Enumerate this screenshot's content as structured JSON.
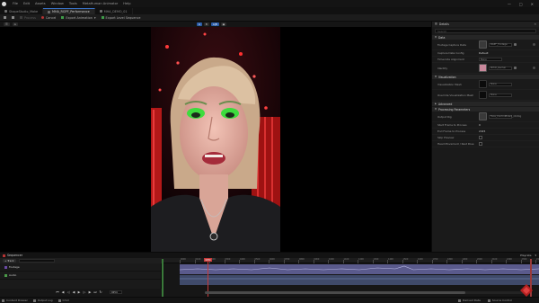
{
  "menubar": {
    "items": [
      "File",
      "Edit",
      "Assets",
      "Window",
      "Tools",
      "MetaHuman Animator",
      "Help"
    ]
  },
  "tabs": [
    {
      "label": "ShapeStudio_Make",
      "active": false
    },
    {
      "label": "MHA_RGPF_Performance",
      "active": true
    },
    {
      "label": "MHA_DEMO_01",
      "active": false
    }
  ],
  "toolbar": {
    "process": "Process",
    "cancel": "Cancel",
    "export_animation": "Export Animation",
    "export_level_sequence": "Export Level Sequence"
  },
  "viewport_strip": {
    "left_chips": [
      "☰",
      "A"
    ],
    "center_chips": [
      "A",
      "B",
      "A|B",
      "▣"
    ]
  },
  "details": {
    "title": "Details",
    "search_placeholder": "Search",
    "sections": {
      "data": "Data",
      "visualization": "Visualization",
      "advanced": "Advanced",
      "processing": "Processing Parameters"
    },
    "props": {
      "footage_capture_data": {
        "label": "Footage Capture Data",
        "value": "RGPF_Footage"
      },
      "capture_data_config": {
        "label": "Capture Data Config",
        "value": "Default"
      },
      "timecode_alignment": {
        "label": "Timecode Alignment",
        "value": "None"
      },
      "identity": {
        "label": "Identity",
        "value": "MHID_Rachel"
      },
      "visualization_mesh": {
        "label": "Visualization Mesh",
        "value": "None"
      },
      "control_rig": {
        "label": "Override Visualization Mesh",
        "value": "None"
      },
      "output_rig": {
        "label": "Output Rig",
        "value": "Face_ControlBoard_CtrlRig"
      },
      "start_frame": {
        "label": "Start Frame to Process",
        "value": "0"
      },
      "end_frame": {
        "label": "End Frame to Process",
        "value": "2415"
      },
      "skip_preview": {
        "label": "Skip Preview"
      },
      "neutral_pose": {
        "label": "Head Movement / Rest Pose"
      }
    }
  },
  "sequencer": {
    "tab_label": "Sequencer",
    "track_button": "+ Track",
    "right_label": "Playrate",
    "tracks": [
      "Footage",
      "Audio"
    ],
    "ruler_labels": [
      "0000",
      "0100",
      "0200",
      "0300",
      "0400",
      "0500",
      "0600",
      "0700",
      "0800",
      "0900",
      "1000",
      "1100",
      "1200",
      "1300",
      "1400",
      "1500",
      "1600",
      "1700",
      "1800",
      "1900",
      "2000",
      "2100",
      "2200",
      "2300",
      "2400"
    ],
    "playhead_frame": "0254",
    "current_frame": "0254"
  },
  "statusbar": {
    "content_drawer": "Content Drawer",
    "output_log": "Output Log",
    "cmd": "Cmd",
    "source_control": "Source Control",
    "derived_data": "Derived Data"
  },
  "colors": {
    "accent": "#3a74c9",
    "record": "#b43333",
    "playhead": "#c53a3a"
  }
}
